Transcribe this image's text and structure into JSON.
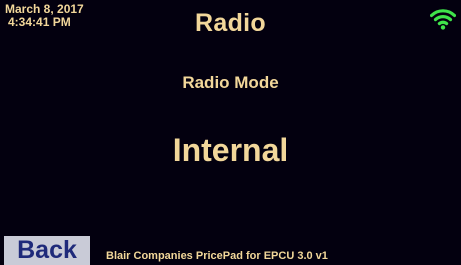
{
  "status": {
    "date": "March 8, 2017",
    "time": "4:34:41 PM",
    "wifi_icon": "wifi-signal-icon",
    "wifi_color": "#3fe44a"
  },
  "header": {
    "title": "Radio"
  },
  "main": {
    "mode_label": "Radio Mode",
    "mode_value": "Internal"
  },
  "footer": {
    "back_label": "Back",
    "product_text": "Blair Companies PricePad for EPCU 3.0 v1"
  },
  "colors": {
    "background": "#03000f",
    "text": "#f2d79a",
    "button_bg": "#c9cbd7",
    "button_text": "#1f2a7a"
  }
}
